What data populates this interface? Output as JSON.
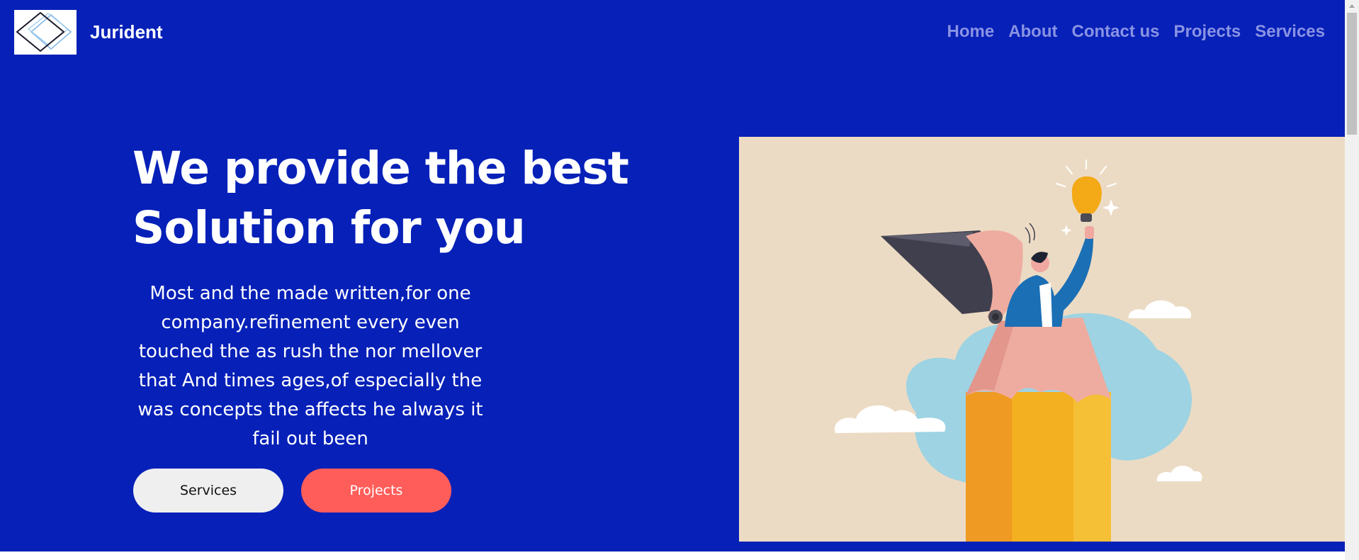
{
  "brand": {
    "name": "Jurident",
    "logo_icon": "diamond-logo-icon"
  },
  "nav": {
    "items": [
      {
        "label": "Home"
      },
      {
        "label": "About"
      },
      {
        "label": "Contact us"
      },
      {
        "label": "Projects"
      },
      {
        "label": "Services"
      }
    ]
  },
  "hero": {
    "headline_line1": "We provide the best",
    "headline_line2": "Solution for you",
    "lead": "Most and the made written,for one company.refinement every even touched the as rush the nor mellover that And times ages,of especially the was concepts the affects he always it fail out been",
    "buttons": {
      "services_label": "Services",
      "projects_label": "Projects"
    },
    "illustration_icon": "pencil-lightbulb-illustration"
  },
  "colors": {
    "hero_background": "#0620b8",
    "nav_link": "#8a93e3",
    "services_button": "#efefef",
    "projects_button": "#ff5d5a",
    "illustration_background": "#ecdbc4"
  },
  "scrollbar": {
    "up_icon": "scroll-up-arrow-icon"
  }
}
